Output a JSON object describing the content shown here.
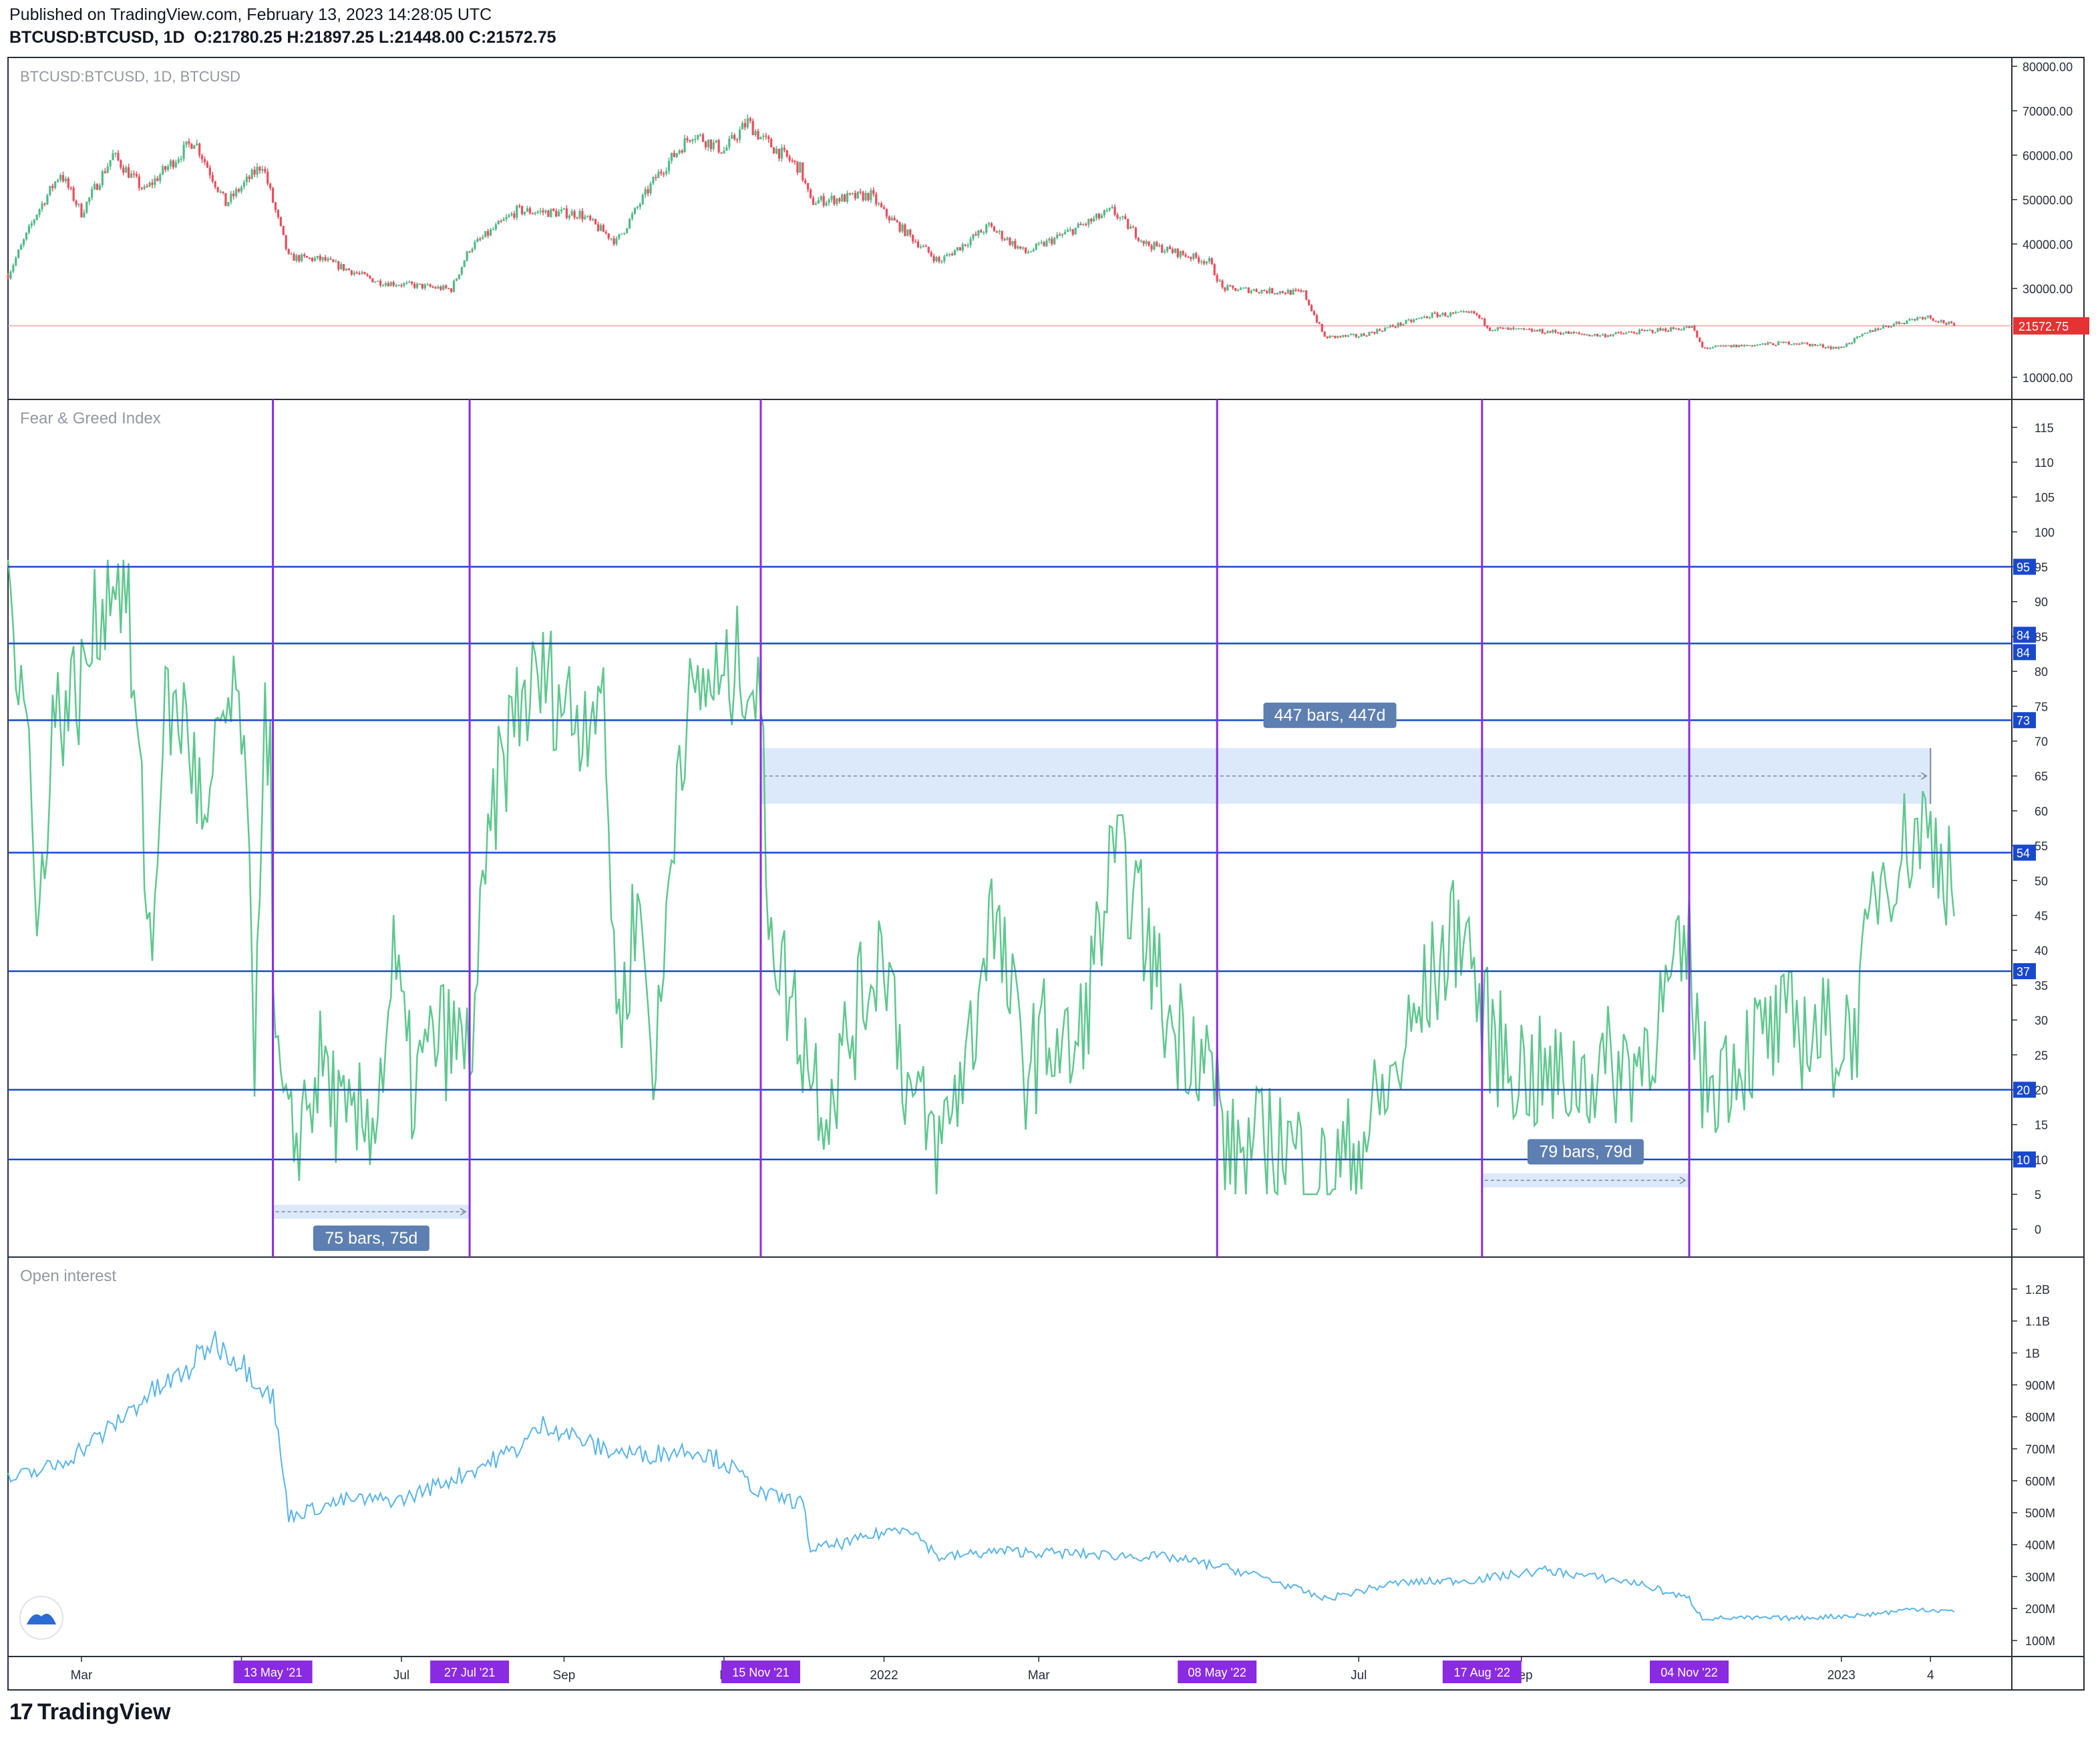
{
  "header": {
    "published": "Published on TradingView.com, February 13, 2023 14:28:05 UTC",
    "symbol": "BTCUSD:BTCUSD, 1D",
    "open_label": "O:",
    "open": "21780.25",
    "high_label": "H:",
    "high": "21897.25",
    "low_label": "L:",
    "low": "21448.00",
    "close_label": "C:",
    "close": "21572.75"
  },
  "brand": {
    "name": "TradingView",
    "logo_text": "17"
  },
  "colors": {
    "up_candle": "#53b987",
    "down_candle": "#eb4d5c",
    "fng_line": "#5fc78e",
    "oi_line": "#5ab4e8",
    "hline": "#1848cc",
    "vline": "#8a2be2",
    "range_fill": "#dce9fb",
    "price_line": "#f4a3a3",
    "price_tag": "#e63232"
  },
  "chart_data": [
    {
      "type": "candlestick",
      "title": "BTCUSD:BTCUSD, 1D, BTCUSD",
      "ylim": [
        5000,
        82000
      ],
      "y_ticks": [
        "80000.00",
        "70000.00",
        "60000.00",
        "50000.00",
        "40000.00",
        "30000.00",
        "10000.00"
      ],
      "last_price_label": "21572.75",
      "last_price": 21572.75,
      "approx_close_path": [
        [
          "2021-02-01",
          33000
        ],
        [
          "2021-02-12",
          47000
        ],
        [
          "2021-02-21",
          56000
        ],
        [
          "2021-03-01",
          47000
        ],
        [
          "2021-03-13",
          60000
        ],
        [
          "2021-03-25",
          52000
        ],
        [
          "2021-04-13",
          63500
        ],
        [
          "2021-04-25",
          49000
        ],
        [
          "2021-05-09",
          58000
        ],
        [
          "2021-05-13",
          49500
        ],
        [
          "2021-05-19",
          37000
        ],
        [
          "2021-06-01",
          36500
        ],
        [
          "2021-06-22",
          31500
        ],
        [
          "2021-07-20",
          29800
        ],
        [
          "2021-07-27",
          39000
        ],
        [
          "2021-08-14",
          47500
        ],
        [
          "2021-08-31",
          47000
        ],
        [
          "2021-09-07",
          46800
        ],
        [
          "2021-09-21",
          40500
        ],
        [
          "2021-10-06",
          55000
        ],
        [
          "2021-10-20",
          65000
        ],
        [
          "2021-11-01",
          61000
        ],
        [
          "2021-11-10",
          67500
        ],
        [
          "2021-11-15",
          64000
        ],
        [
          "2021-11-30",
          57000
        ],
        [
          "2021-12-04",
          49500
        ],
        [
          "2021-12-27",
          51000
        ],
        [
          "2022-01-01",
          47000
        ],
        [
          "2022-01-22",
          36000
        ],
        [
          "2022-02-10",
          44000
        ],
        [
          "2022-02-24",
          38000
        ],
        [
          "2022-03-29",
          47500
        ],
        [
          "2022-04-11",
          40000
        ],
        [
          "2022-05-05",
          36000
        ],
        [
          "2022-05-10",
          30000
        ],
        [
          "2022-06-10",
          29000
        ],
        [
          "2022-06-18",
          19000
        ],
        [
          "2022-07-01",
          19300
        ],
        [
          "2022-07-29",
          24000
        ],
        [
          "2022-08-14",
          24400
        ],
        [
          "2022-08-20",
          21000
        ],
        [
          "2022-09-13",
          20200
        ],
        [
          "2022-10-01",
          19400
        ],
        [
          "2022-11-05",
          21300
        ],
        [
          "2022-11-09",
          16600
        ],
        [
          "2022-12-14",
          17800
        ],
        [
          "2022-12-31",
          16550
        ],
        [
          "2023-01-14",
          20900
        ],
        [
          "2023-02-02",
          23800
        ],
        [
          "2023-02-13",
          21572
        ]
      ]
    },
    {
      "type": "line",
      "title": "Fear & Greed Index",
      "ylim": [
        -4,
        119
      ],
      "y_ticks": [
        115,
        110,
        105,
        100,
        95,
        90,
        85,
        80,
        75,
        70,
        65,
        60,
        55,
        50,
        45,
        40,
        35,
        30,
        25,
        20,
        15,
        10,
        5,
        0
      ],
      "horizontal_levels": [
        95,
        84,
        73,
        54,
        37,
        20,
        10
      ],
      "level_labels": [
        "95",
        "84",
        "84",
        "73",
        "54",
        "37",
        "20",
        "10"
      ],
      "vertical_markers": [
        "13 May '21",
        "27 Jul '21",
        "15 Nov '21",
        "08 May '22",
        "17 Aug '22",
        "04 Nov '22"
      ],
      "approx_path": [
        [
          "2021-02-01",
          90
        ],
        [
          "2021-02-08",
          79
        ],
        [
          "2021-02-12",
          40
        ],
        [
          "2021-02-18",
          73
        ],
        [
          "2021-03-01",
          78
        ],
        [
          "2021-03-12",
          95
        ],
        [
          "2021-03-18",
          92
        ],
        [
          "2021-03-25",
          54
        ],
        [
          "2021-03-28",
          38
        ],
        [
          "2021-04-01",
          74
        ],
        [
          "2021-04-10",
          73
        ],
        [
          "2021-04-18",
          54
        ],
        [
          "2021-04-23",
          73
        ],
        [
          "2021-05-01",
          74
        ],
        [
          "2021-05-06",
          27
        ],
        [
          "2021-05-09",
          68
        ],
        [
          "2021-05-12",
          74
        ],
        [
          "2021-05-13",
          28
        ],
        [
          "2021-05-19",
          11
        ],
        [
          "2021-06-01",
          24
        ],
        [
          "2021-06-10",
          13
        ],
        [
          "2021-06-22",
          18
        ],
        [
          "2021-06-28",
          38
        ],
        [
          "2021-07-05",
          20
        ],
        [
          "2021-07-15",
          28
        ],
        [
          "2021-07-27",
          25
        ],
        [
          "2021-08-05",
          60
        ],
        [
          "2021-08-14",
          75
        ],
        [
          "2021-08-25",
          79
        ],
        [
          "2021-09-07",
          73
        ],
        [
          "2021-09-15",
          79
        ],
        [
          "2021-09-22",
          28
        ],
        [
          "2021-09-29",
          48
        ],
        [
          "2021-10-06",
          22
        ],
        [
          "2021-10-15",
          71
        ],
        [
          "2021-10-26",
          79
        ],
        [
          "2021-11-01",
          77
        ],
        [
          "2021-11-08",
          82
        ],
        [
          "2021-11-15",
          75
        ],
        [
          "2021-11-17",
          52
        ],
        [
          "2021-11-22",
          38
        ],
        [
          "2021-12-04",
          24
        ],
        [
          "2021-12-10",
          18
        ],
        [
          "2021-12-20",
          29
        ],
        [
          "2022-01-01",
          42
        ],
        [
          "2022-01-10",
          20
        ],
        [
          "2022-01-22",
          11
        ],
        [
          "2022-02-05",
          30
        ],
        [
          "2022-02-10",
          47
        ],
        [
          "2022-02-24",
          23
        ],
        [
          "2022-03-04",
          28
        ],
        [
          "2022-03-15",
          24
        ],
        [
          "2022-03-29",
          52
        ],
        [
          "2022-04-05",
          50
        ],
        [
          "2022-04-20",
          29
        ],
        [
          "2022-05-01",
          27
        ],
        [
          "2022-05-08",
          20
        ],
        [
          "2022-05-12",
          10
        ],
        [
          "2022-06-01",
          13
        ],
        [
          "2022-06-18",
          7
        ],
        [
          "2022-07-01",
          12
        ],
        [
          "2022-07-15",
          22
        ],
        [
          "2022-07-28",
          35
        ],
        [
          "2022-08-10",
          45
        ],
        [
          "2022-08-17",
          30
        ],
        [
          "2022-08-25",
          25
        ],
        [
          "2022-09-05",
          22
        ],
        [
          "2022-09-15",
          21
        ],
        [
          "2022-10-01",
          23
        ],
        [
          "2022-10-15",
          24
        ],
        [
          "2022-10-28",
          34
        ],
        [
          "2022-11-04",
          40
        ],
        [
          "2022-11-09",
          21
        ],
        [
          "2022-12-01",
          27
        ],
        [
          "2022-12-15",
          29
        ],
        [
          "2023-01-01",
          27
        ],
        [
          "2023-01-08",
          31
        ],
        [
          "2023-01-14",
          50
        ],
        [
          "2023-01-25",
          55
        ],
        [
          "2023-02-01",
          58
        ],
        [
          "2023-02-07",
          55
        ],
        [
          "2023-02-13",
          50
        ]
      ],
      "ranges": [
        {
          "label": "75 bars, 75d"
        },
        {
          "label": "447 bars, 447d"
        },
        {
          "label": "79 bars, 79d"
        }
      ]
    },
    {
      "type": "line",
      "title": "Open interest",
      "ylim": [
        50000000,
        1300000000
      ],
      "y_ticks": [
        "1.2B",
        "1.1B",
        "1B",
        "900M",
        "800M",
        "700M",
        "600M",
        "500M",
        "400M",
        "300M",
        "200M",
        "100M"
      ],
      "approx_path": [
        [
          "2021-02-01",
          600
        ],
        [
          "2021-02-20",
          650
        ],
        [
          "2021-03-10",
          750
        ],
        [
          "2021-03-25",
          860
        ],
        [
          "2021-04-10",
          940
        ],
        [
          "2021-04-20",
          1040
        ],
        [
          "2021-05-01",
          970
        ],
        [
          "2021-05-13",
          860
        ],
        [
          "2021-05-19",
          490
        ],
        [
          "2021-06-10",
          540
        ],
        [
          "2021-07-01",
          540
        ],
        [
          "2021-07-27",
          630
        ],
        [
          "2021-08-14",
          700
        ],
        [
          "2021-08-25",
          780
        ],
        [
          "2021-09-15",
          700
        ],
        [
          "2021-10-01",
          680
        ],
        [
          "2021-10-20",
          700
        ],
        [
          "2021-11-01",
          660
        ],
        [
          "2021-11-15",
          560
        ],
        [
          "2021-12-01",
          530
        ],
        [
          "2021-12-04",
          385
        ],
        [
          "2021-12-20",
          410
        ],
        [
          "2022-01-10",
          460
        ],
        [
          "2022-01-22",
          360
        ],
        [
          "2022-02-15",
          380
        ],
        [
          "2022-03-20",
          370
        ],
        [
          "2022-04-20",
          360
        ],
        [
          "2022-05-10",
          330
        ],
        [
          "2022-05-25",
          300
        ],
        [
          "2022-06-18",
          230
        ],
        [
          "2022-07-15",
          280
        ],
        [
          "2022-08-14",
          290
        ],
        [
          "2022-09-10",
          320
        ],
        [
          "2022-10-15",
          280
        ],
        [
          "2022-11-04",
          230
        ],
        [
          "2022-11-09",
          170
        ],
        [
          "2022-12-15",
          170
        ],
        [
          "2023-01-10",
          180
        ],
        [
          "2023-01-30",
          200
        ],
        [
          "2023-02-13",
          190
        ]
      ]
    }
  ],
  "x_axis": {
    "ticks": [
      {
        "date": "2021-03-01",
        "label": "Mar"
      },
      {
        "date": "2021-05-01",
        "label": "M"
      },
      {
        "date": "2021-07-01",
        "label": "Jul"
      },
      {
        "date": "2021-09-01",
        "label": "Sep"
      },
      {
        "date": "2021-11-01",
        "label": "N"
      },
      {
        "date": "2022-01-01",
        "label": "2022"
      },
      {
        "date": "2022-03-01",
        "label": "Mar"
      },
      {
        "date": "2022-07-01",
        "label": "Jul"
      },
      {
        "date": "2022-09-01",
        "label": "Sep"
      },
      {
        "date": "2023-01-01",
        "label": "2023"
      },
      {
        "date": "2023-02-04",
        "label": "4"
      }
    ],
    "marker_dates": [
      "2021-05-13",
      "2021-07-27",
      "2021-11-15",
      "2022-05-08",
      "2022-08-17",
      "2022-11-04"
    ],
    "range_dates": [
      [
        "2021-05-13",
        "2021-07-27"
      ],
      [
        "2021-11-15",
        "2023-02-04"
      ],
      [
        "2022-08-17",
        "2022-11-04"
      ]
    ]
  }
}
